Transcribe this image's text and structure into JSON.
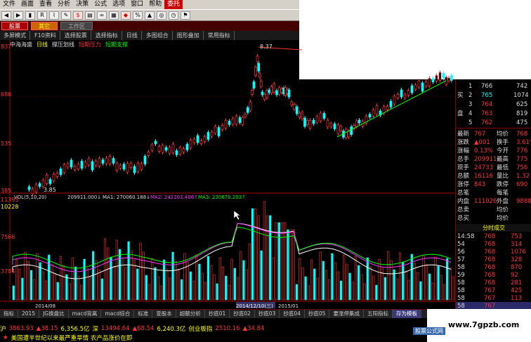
{
  "menu": [
    "文件",
    "画面",
    "查看",
    "分析",
    "决策",
    "公式",
    "选项",
    "窗口",
    "帮助",
    "委托"
  ],
  "toolbar_icons": [
    "back-icon",
    "forward-icon",
    "bar-icon",
    "rsi-icon",
    "chart-icon",
    "pen-icon",
    "dollar-icon",
    "book-icon",
    "binoculars-icon",
    "grid-icon",
    "diamond-icon",
    "percent-icon",
    "stock-icon",
    "globe-icon",
    "clock-icon",
    "pin-icon"
  ],
  "tabs": {
    "t1": "股票",
    "t2": "其它",
    "t3": "工作区"
  },
  "funcbar": [
    "多屏模式",
    "F10资料",
    "选择股票",
    "选择指标",
    "日线",
    "多图组合",
    "图形叠加",
    "常用指标"
  ],
  "chart_title": {
    "name": "中海海盛",
    "period": "日线",
    "indicator": "撑压划线",
    "res": "短期压力",
    "sup": "短期支撑"
  },
  "price_axis": [
    "837",
    "686",
    "535",
    "385"
  ],
  "price_labels": {
    "high": "8.37",
    "low": "3.85"
  },
  "vol_axis": [
    "11393",
    "10228",
    "7566",
    "3784"
  ],
  "vol_header": {
    "a": "VOL(5,10,20)",
    "b": "209911.000↓",
    "c": "MA1: 270060.188↓",
    "d": "MA2: 242202.406↑",
    "e": "MA3: 220870.203↑"
  },
  "date_labels": {
    "d1": "2014/08",
    "d2": "2014/12/10(三)",
    "d3": "2015/01"
  },
  "order_book": {
    "sell": [
      [
        "1",
        "766",
        "742"
      ],
      [
        "2",
        "765",
        "1074"
      ],
      [
        "3",
        "764",
        "625"
      ],
      [
        "4",
        "763",
        "819"
      ],
      [
        "5",
        "762",
        "475"
      ]
    ],
    "labels": {
      "buy": "买",
      "pan": "盘"
    }
  },
  "stats": [
    [
      "最新",
      "767",
      "均价",
      "768"
    ],
    [
      "涨跌",
      "▲001",
      "换手",
      "3.61%"
    ],
    [
      "涨幅",
      "0.13%",
      "今开",
      "776"
    ],
    [
      "总手",
      "209911",
      "最高",
      "775"
    ],
    [
      "现手",
      "24733",
      "最低",
      "756"
    ],
    [
      "总额",
      "16116",
      "量比",
      "1.32"
    ],
    [
      "涨停",
      "843",
      "跌停",
      "690"
    ],
    [
      "总笔",
      "",
      "每笔",
      ""
    ],
    [
      "内盘",
      "111026",
      "外盘",
      "98885"
    ],
    [
      "总卖",
      "",
      "均价",
      ""
    ],
    [
      "总买",
      "",
      "均价",
      ""
    ]
  ],
  "tick_header": "分时成交",
  "ticks": [
    [
      "14:58",
      "768",
      "753"
    ],
    [
      "54",
      "768",
      "314"
    ],
    [
      "56",
      "768",
      "1076"
    ],
    [
      "57",
      "768",
      "328"
    ],
    [
      "58",
      "768",
      "870"
    ],
    [
      "59",
      "768",
      "92"
    ],
    [
      "58",
      "768",
      "281"
    ],
    [
      "58",
      "767",
      "425"
    ],
    [
      "58",
      "767",
      "113"
    ],
    [
      "58",
      "767",
      ""
    ]
  ],
  "bottom_tabs": [
    "指标",
    "2015",
    "JG换盘比",
    "macd背离",
    "macd综合",
    "标准",
    "查股本",
    "超额分析",
    "抄底01",
    "抄底02",
    "抄底03",
    "抄底04",
    "抄底05",
    "要涨停集成",
    "五阳指标",
    "存为模板"
  ],
  "ticker": {
    "sh_label": "沪",
    "sh_val": "3863.93",
    "sh_chg": "▲38.15",
    "sh_amt": "6,356.5亿",
    "sz_label": "深",
    "sz_val": "13494.64",
    "sz_chg": "▲68.54",
    "sz_amt": "6,240.3亿",
    "cy_label": "创业板指",
    "cy_val": "2510.16",
    "cy_chg": "▲34.84"
  },
  "news": "美国遭半世纪以来最严重旱情 农产品涨价在即",
  "watermark": "www.7gpzb.com",
  "logo_label": "股票公式网",
  "colors": {
    "up": "#ff3333",
    "down": "#00ffff",
    "ma": "#ffffff",
    "accent": "#ffff00"
  }
}
